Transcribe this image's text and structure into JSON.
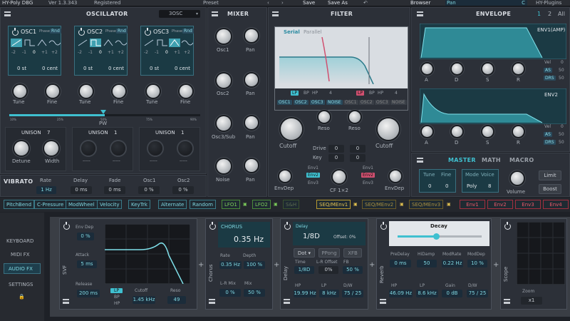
{
  "topbar": {
    "app": "HY-Poly DBG",
    "version": "Ver 1.3.343",
    "registered": "Registered",
    "preset_label": "Preset",
    "save": "Save",
    "save_as": "Save As",
    "browser": "Browser",
    "pan_field": "Pan",
    "pan_value": "C",
    "brand": "HY-Plugins"
  },
  "osc": {
    "title": "OSCILLATOR",
    "mode": "3OSC",
    "units": [
      {
        "name": "OSC1",
        "phase": "Phase",
        "rnd": "Rnd",
        "oct": [
          "-2",
          "-1",
          "0",
          "+1",
          "+2"
        ],
        "st": "0 st",
        "cent": "0 cent",
        "tune": "Tune",
        "fine": "Fine",
        "unison_label": "UNISON",
        "unison_val": "7",
        "detune": "Detune",
        "width": "Width"
      },
      {
        "name": "OSC2",
        "phase": "Phase",
        "rnd": "Rnd",
        "oct": [
          "-2",
          "-1",
          "0",
          "+1",
          "+2"
        ],
        "st": "0 st",
        "cent": "0 cent",
        "tune": "Tune",
        "fine": "Fine",
        "unison_label": "UNISON",
        "unison_val": "1",
        "detune": "-----",
        "width": "-----"
      },
      {
        "name": "OSC3",
        "phase": "Phase",
        "rnd": "Rnd",
        "oct": [
          "-2",
          "-1",
          "0",
          "+1",
          "+2"
        ],
        "st": "0 st",
        "cent": "0 cent",
        "tune": "Tune",
        "fine": "Fine",
        "unison_label": "UNISON",
        "unison_val": "1",
        "detune": "-----",
        "width": "-----"
      }
    ],
    "pw_ticks": [
      "10%",
      "25%",
      "50%",
      "75%",
      "90%"
    ],
    "pw": "PW"
  },
  "vibrato": {
    "title": "VIBRATO",
    "cols": [
      {
        "l": "Rate",
        "v": "1 Hz"
      },
      {
        "l": "Delay",
        "v": "0 ms"
      },
      {
        "l": "Fade",
        "v": "0 ms"
      },
      {
        "l": "Osc1",
        "v": "0 %"
      },
      {
        "l": "Osc2",
        "v": "0 %"
      }
    ]
  },
  "mixer": {
    "title": "MIXER",
    "rows": [
      {
        "a": "Osc1",
        "b": "Pan"
      },
      {
        "a": "Osc2",
        "b": "Pan"
      },
      {
        "a": "Osc3/Sub",
        "b": "Pan"
      },
      {
        "a": "Noise",
        "b": "Pan"
      }
    ]
  },
  "filter": {
    "title": "FILTER",
    "serial": "Serial",
    "parallel": "Parallel",
    "types": [
      "LP",
      "BP",
      "HP"
    ],
    "slope": "4",
    "routes1": [
      "OSC1",
      "OSC2",
      "OSC3",
      "NOISE"
    ],
    "routes2": [
      "OSC1",
      "OSC2",
      "OSC3",
      "NOISE"
    ],
    "cutoff": "Cutoff",
    "reso": "Reso",
    "drive": "Drive",
    "key": "Key",
    "drive_v": "0",
    "key_v": "0",
    "envdep": "EnvDep",
    "cf": "CF 1×2",
    "env_opts": [
      "Env1",
      "Env2",
      "Env3"
    ]
  },
  "envelope": {
    "title": "ENVELOPE",
    "pages": [
      "1",
      "2",
      "All"
    ],
    "env1": "ENV1(AMP)",
    "env2": "ENV2",
    "adsr": [
      "A",
      "D",
      "S",
      "R"
    ],
    "vel": "Vel",
    "vel_v": "0",
    "as": "AS",
    "as_v": "50",
    "drs": "DRS",
    "drs_v": "50"
  },
  "master": {
    "tabs": [
      "MASTER",
      "MATH",
      "MACRO"
    ],
    "tune": "Tune",
    "fine": "Fine",
    "tune_v": "0",
    "fine_v": "0",
    "mode": "Mode",
    "voice": "Voice",
    "mode_v": "Poly",
    "voice_v": "8",
    "volume": "Volume",
    "limit": "Limit",
    "boost": "Boost"
  },
  "mods": [
    "PitchBend",
    "C-Pressure",
    "ModWheel",
    "Velocity",
    "KeyTrk",
    "Alternate",
    "Random"
  ],
  "lfos": [
    "LFO1",
    "LFO2",
    "S&H"
  ],
  "seqs": [
    "SEQ/MEnv1",
    "SEQ/MEnv2",
    "SEQ/MEnv3"
  ],
  "envs": [
    "Env1",
    "Env2",
    "Env3",
    "Env4"
  ],
  "side": {
    "items": [
      "KEYBOARD",
      "MIDI FX",
      "AUDIO FX",
      "SETTINGS"
    ]
  },
  "fx": {
    "svf": {
      "label": "SVF",
      "envdep": "Env Dep",
      "envdep_v": "0 %",
      "attack": "Attack",
      "attack_v": "5 ms",
      "release": "Release",
      "release_v": "200 ms",
      "types": [
        "LP",
        "BP",
        "HP"
      ],
      "cutoff": "Cutoff",
      "cutoff_v": "1.45 kHz",
      "reso": "Reso",
      "reso_v": "49"
    },
    "chorus": {
      "label": "Chorus",
      "title": "CHORUS",
      "big": "0.35 Hz",
      "rate": "Rate",
      "rate_v": "0.35 Hz",
      "depth": "Depth",
      "depth_v": "100 %",
      "lr": "L-R Mix",
      "lr_v": "0 %",
      "mix": "Mix",
      "mix_v": "50 %"
    },
    "delay": {
      "label": "Delay",
      "title": "Delay",
      "big": "1/8D",
      "offset": "Offset: 0%",
      "dot": "Dot",
      "ppong": "PPong",
      "xfb": "XFB",
      "time": "Time",
      "time_v": "1/8D",
      "lro": "L-R Offset",
      "lro_v": "0%",
      "fb": "FB",
      "fb_v": "50 %",
      "hp": "HP",
      "hp_v": "19.99 Hz",
      "lp": "LP",
      "lp_v": "8 kHz",
      "dw": "D/W",
      "dw_v": "75 / 25"
    },
    "reverb": {
      "label": "Reverb",
      "title": "Decay",
      "predelay": "PreDelay",
      "predelay_v": "0 ms",
      "hidamp": "HiDamp",
      "hidamp_v": "50",
      "modrate": "ModRate",
      "modrate_v": "0.22 Hz",
      "moddep": "ModDep",
      "moddep_v": "10 %",
      "hp": "HP",
      "hp_v": "46.09 Hz",
      "lp": "LP",
      "lp_v": "8.6 kHz",
      "gain": "Gain",
      "gain_v": "0 dB",
      "dw": "D/W",
      "dw_v": "75 / 25"
    },
    "scope": {
      "label": "Scope",
      "zoom": "Zoom",
      "zoom_v": "x1"
    }
  },
  "colors": {
    "accent": "#3fc0d0",
    "seq": "#d8b640",
    "env": "#d04050",
    "lfo": "#5ab84a"
  }
}
